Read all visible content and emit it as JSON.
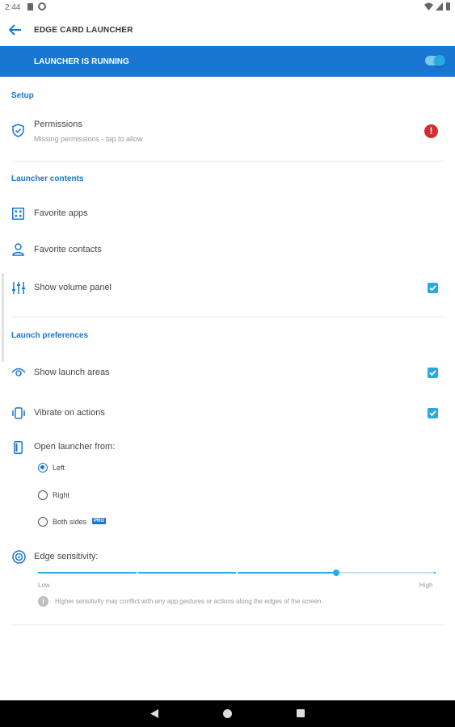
{
  "status_bar": {
    "time": "2:44"
  },
  "app_bar": {
    "title": "EDGE CARD LAUNCHER"
  },
  "banner": {
    "label": "LAUNCHER IS RUNNING",
    "toggle_on": true
  },
  "sections": {
    "setup": "Setup",
    "launcher_contents": "Launcher contents",
    "launch_preferences": "Launch preferences"
  },
  "permissions": {
    "title": "Permissions",
    "subtitle": "Missing permissions - tap to allow"
  },
  "favorite_apps": {
    "label": "Favorite apps"
  },
  "favorite_contacts": {
    "label": "Favorite contacts"
  },
  "volume_panel": {
    "label": "Show volume panel",
    "checked": true
  },
  "launch_areas": {
    "label": "Show launch areas",
    "checked": true
  },
  "vibrate": {
    "label": "Vibrate on actions",
    "checked": true
  },
  "open_from": {
    "label": "Open launcher from:",
    "options": [
      "Left",
      "Right",
      "Both sides"
    ],
    "selected": "Left",
    "pro_badge": "PRO"
  },
  "edge_sensitivity": {
    "label": "Edge sensitivity:",
    "low_label": "Low",
    "high_label": "High",
    "value": 0.75,
    "note": "Higher sensitivity may conflict with any app gestures or actions along the edges of the screen."
  },
  "colors": {
    "accent": "#1976D2",
    "toggle": "#29A9E1",
    "error": "#D32F2F"
  }
}
